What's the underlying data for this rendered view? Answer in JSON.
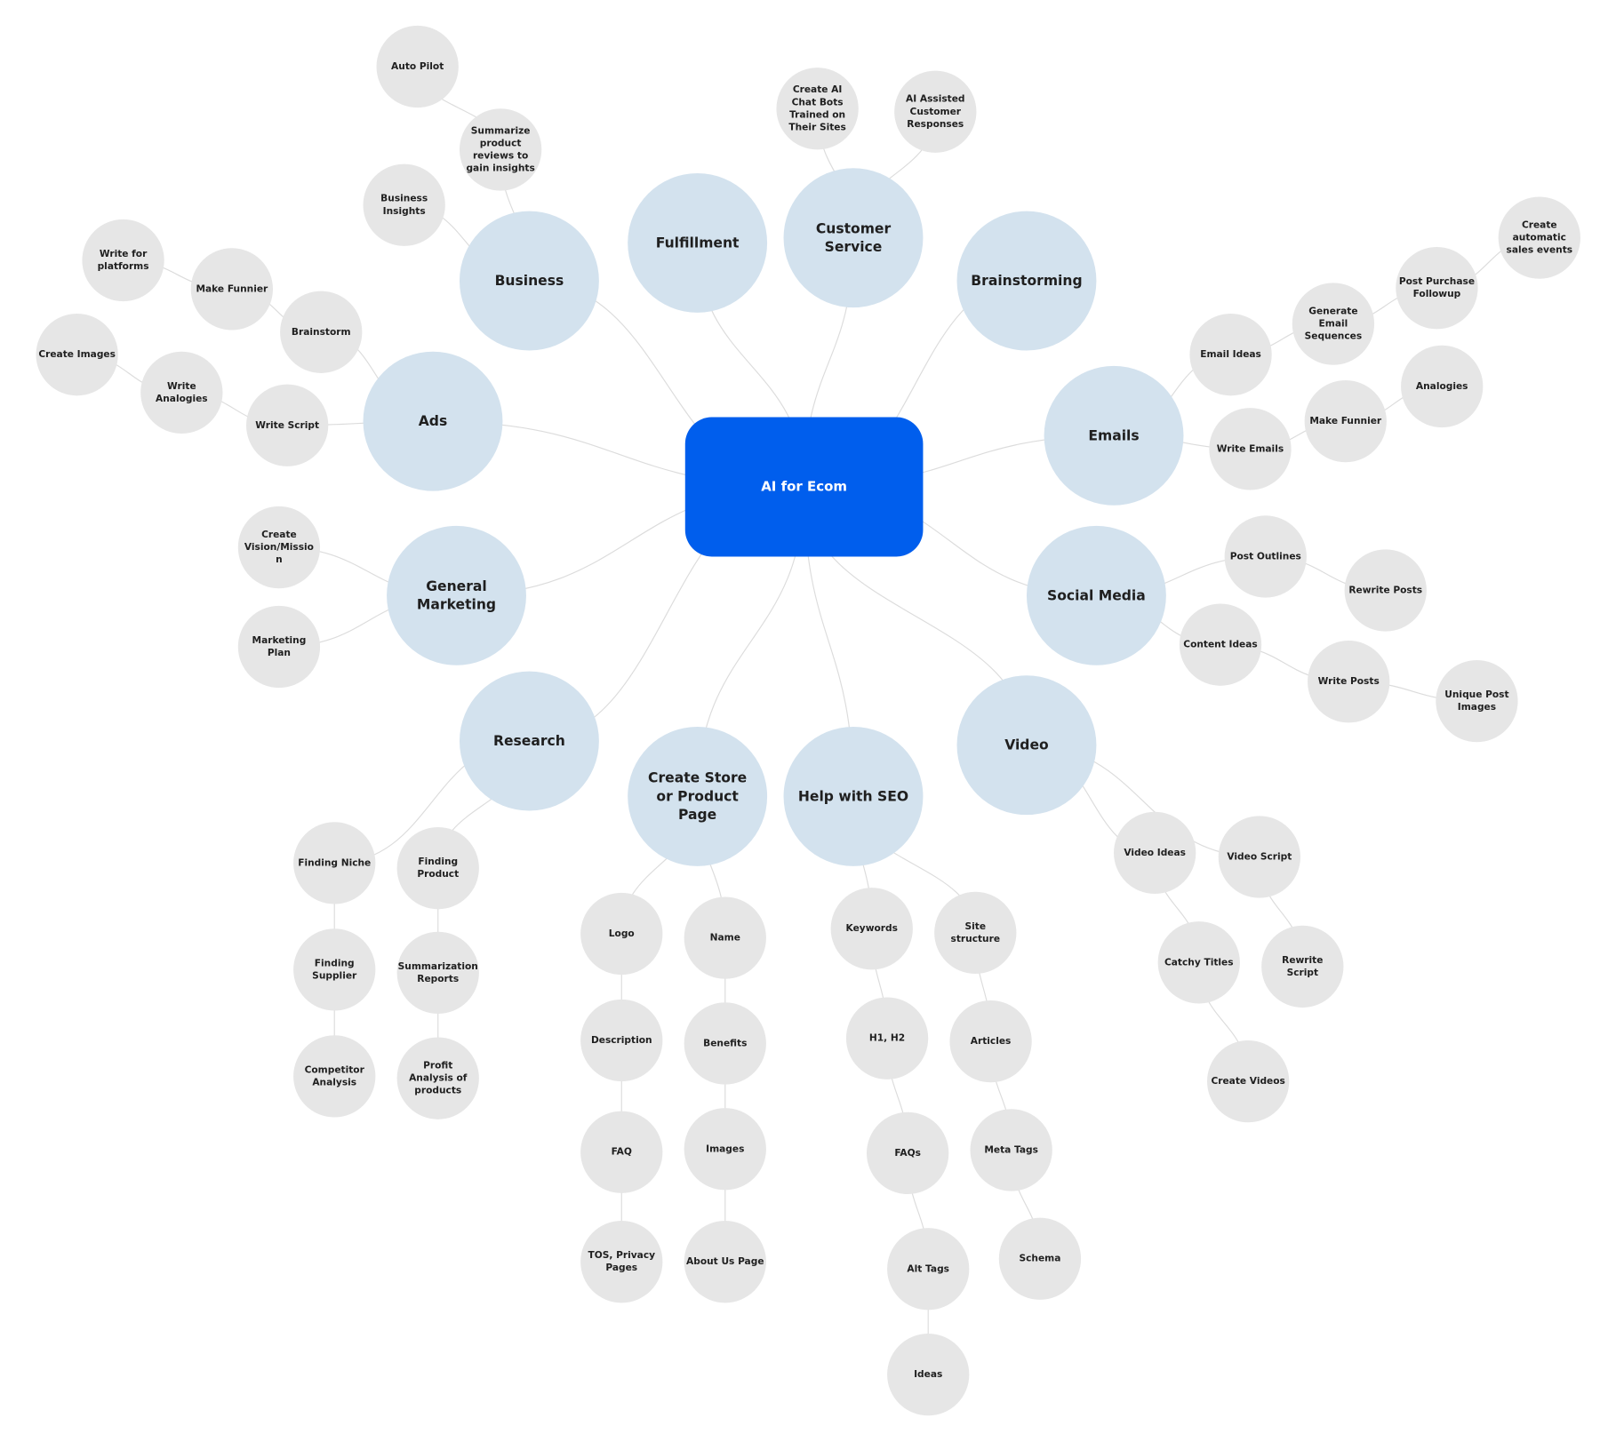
{
  "colors": {
    "root": "#005eed",
    "branch": "#d3e2ee",
    "leaf": "#e6e6e6",
    "edge": "#dcdcdc"
  },
  "root": {
    "label": "AI for Ecom"
  },
  "branches": [
    {
      "label": "Business",
      "children": [
        {
          "label": "Business Insights"
        },
        {
          "label": "Summarize product reviews to gain insights",
          "children": [
            {
              "label": "Auto Pilot"
            }
          ]
        }
      ]
    },
    {
      "label": "Fulfillment"
    },
    {
      "label": "Customer Service",
      "children": [
        {
          "label": "Create AI Chat Bots Trained on Their Sites"
        },
        {
          "label": "AI Assisted Customer Responses"
        }
      ]
    },
    {
      "label": "Brainstorming"
    },
    {
      "label": "Ads",
      "children": [
        {
          "label": "Write Script",
          "children": [
            {
              "label": "Write Analogies",
              "children": [
                {
                  "label": "Create Images"
                }
              ]
            }
          ]
        },
        {
          "label": "Brainstorm",
          "children": [
            {
              "label": "Make Funnier",
              "children": [
                {
                  "label": "Write for platforms"
                }
              ]
            }
          ]
        }
      ]
    },
    {
      "label": "Emails",
      "children": [
        {
          "label": "Email Ideas",
          "children": [
            {
              "label": "Generate Email Sequences",
              "children": [
                {
                  "label": "Post Purchase Followup",
                  "children": [
                    {
                      "label": "Create automatic sales events"
                    }
                  ]
                }
              ]
            }
          ]
        },
        {
          "label": "Write Emails",
          "children": [
            {
              "label": "Make Funnier",
              "children": [
                {
                  "label": "Analogies"
                }
              ]
            }
          ]
        }
      ]
    },
    {
      "label": "General Marketing",
      "children": [
        {
          "label": "Create Vision/Mission"
        },
        {
          "label": "Marketing Plan"
        }
      ]
    },
    {
      "label": "Social Media",
      "children": [
        {
          "label": "Post Outlines",
          "children": [
            {
              "label": "Rewrite Posts"
            }
          ]
        },
        {
          "label": "Content Ideas",
          "children": [
            {
              "label": "Write Posts",
              "children": [
                {
                  "label": "Unique Post Images"
                }
              ]
            }
          ]
        }
      ]
    },
    {
      "label": "Research",
      "children": [
        {
          "label": "Finding Niche",
          "children": [
            {
              "label": "Finding Supplier",
              "children": [
                {
                  "label": "Competitor Analysis"
                }
              ]
            }
          ]
        },
        {
          "label": "Finding Product",
          "children": [
            {
              "label": "Summarization Reports",
              "children": [
                {
                  "label": "Profit Analysis of products"
                }
              ]
            }
          ]
        }
      ]
    },
    {
      "label": "Create Store or Product Page",
      "children": [
        {
          "label": "Logo",
          "children": [
            {
              "label": "Description",
              "children": [
                {
                  "label": "FAQ",
                  "children": [
                    {
                      "label": "TOS, Privacy Pages"
                    }
                  ]
                }
              ]
            }
          ]
        },
        {
          "label": "Name",
          "children": [
            {
              "label": "Benefits",
              "children": [
                {
                  "label": "Images",
                  "children": [
                    {
                      "label": "About Us Page"
                    }
                  ]
                }
              ]
            }
          ]
        }
      ]
    },
    {
      "label": "Help with SEO",
      "children": [
        {
          "label": "Keywords",
          "children": [
            {
              "label": "H1, H2",
              "children": [
                {
                  "label": "FAQs",
                  "children": [
                    {
                      "label": "Alt Tags",
                      "children": [
                        {
                          "label": "Ideas"
                        }
                      ]
                    }
                  ]
                }
              ]
            }
          ]
        },
        {
          "label": "Site structure",
          "children": [
            {
              "label": "Articles",
              "children": [
                {
                  "label": "Meta Tags",
                  "children": [
                    {
                      "label": "Schema"
                    }
                  ]
                }
              ]
            }
          ]
        }
      ]
    },
    {
      "label": "Video",
      "children": [
        {
          "label": "Video Ideas",
          "children": [
            {
              "label": "Catchy Titles",
              "children": [
                {
                  "label": "Create Videos"
                }
              ]
            }
          ]
        },
        {
          "label": "Video Script",
          "children": [
            {
              "label": "Rewrite Script"
            }
          ]
        }
      ]
    }
  ]
}
